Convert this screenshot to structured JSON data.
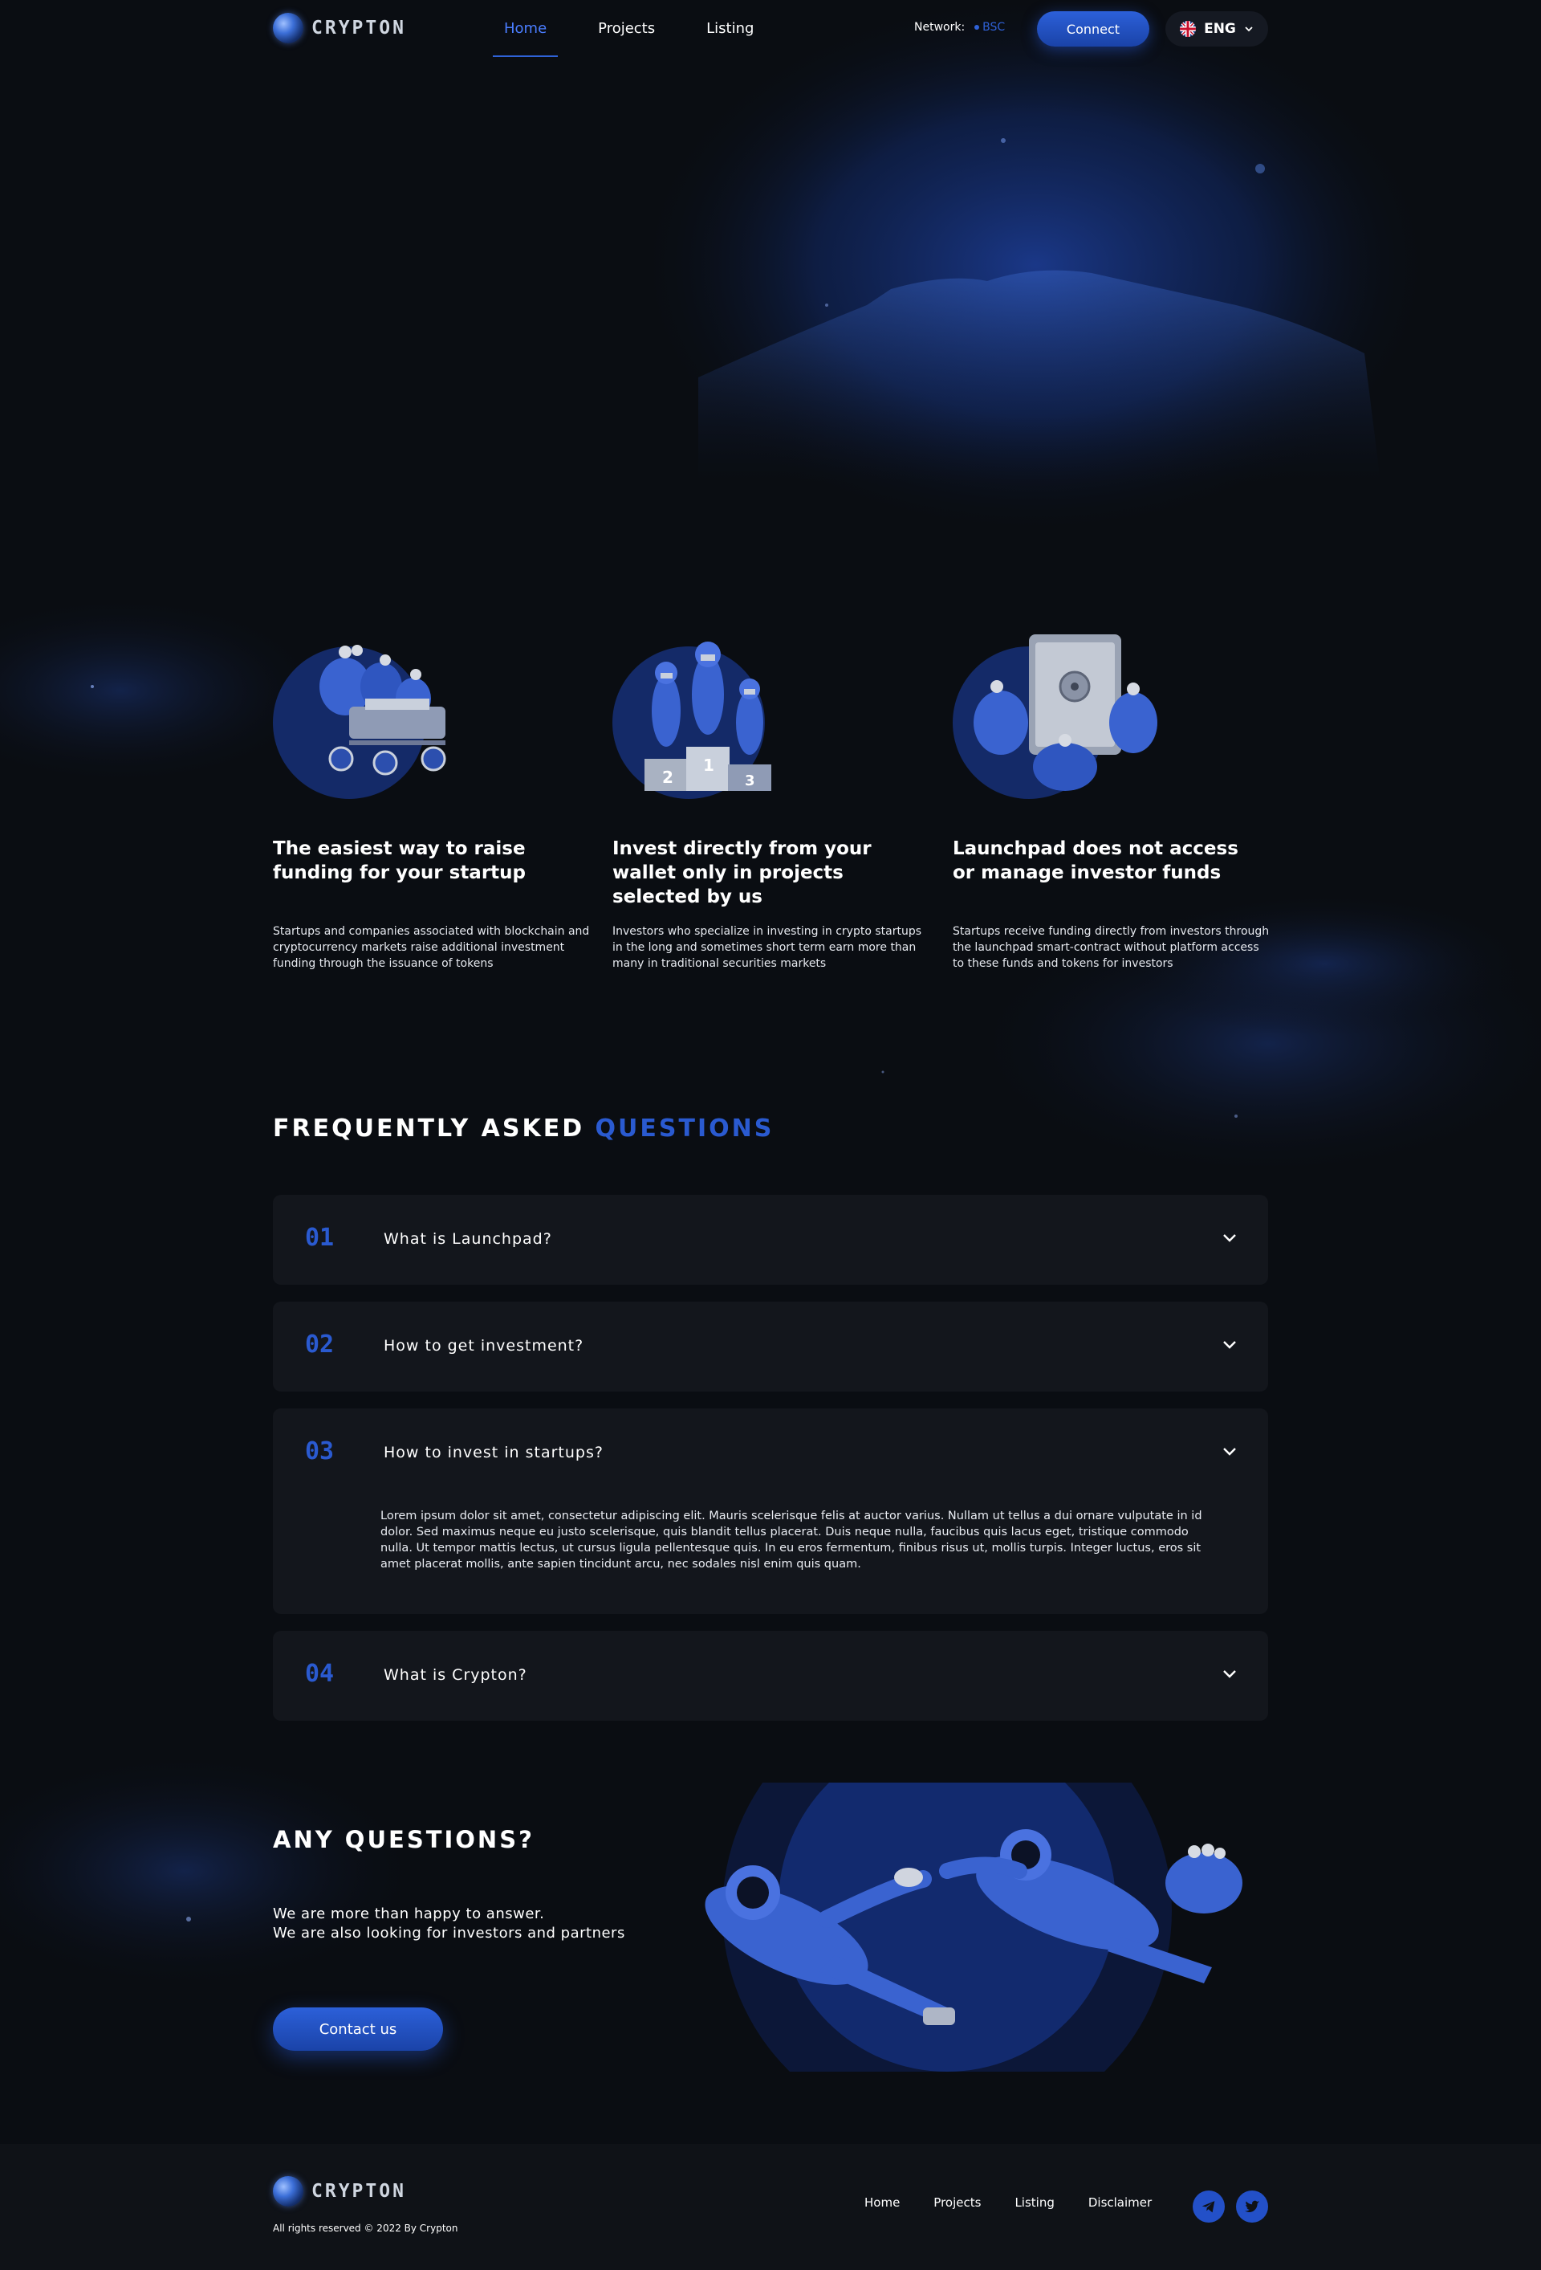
{
  "brand": {
    "name": "CRYPTON"
  },
  "header": {
    "nav": [
      "Home",
      "Projects",
      "Listing"
    ],
    "active_nav": "Home",
    "network_label": "Network:",
    "network_value": "BSC",
    "connect_label": "Connect",
    "language": "ENG"
  },
  "features": [
    {
      "title": "The easiest way to raise funding for your startup",
      "text": "Startups and companies associated with blockchain and cryptocurrency markets raise additional investment funding through the issuance of tokens",
      "illustration": "money-bags-rover"
    },
    {
      "title": "Invest directly from your wallet only in projects selected by us",
      "text": "Investors who specialize in investing in crypto startups in the long and sometimes short term earn more than many in traditional securities markets",
      "illustration": "astronauts-podium"
    },
    {
      "title": "Launchpad does not access or manage investor funds",
      "text": "Startups receive funding directly from investors through the launchpad smart-contract without platform access to these funds and tokens for investors",
      "illustration": "safe-money-bags"
    }
  ],
  "faq": {
    "title_main": "FREQUENTLY ASKED",
    "title_highlight": "QUESTIONS",
    "items": [
      {
        "num": "01",
        "question": "What is Launchpad?",
        "expanded": false
      },
      {
        "num": "02",
        "question": "How to get investment?",
        "expanded": false
      },
      {
        "num": "03",
        "question": "How to invest in startups?",
        "expanded": true,
        "answer": "Lorem ipsum dolor sit amet, consectetur adipiscing elit. Mauris scelerisque felis at auctor varius. Nullam ut tellus a dui ornare vulputate in id dolor. Sed maximus neque eu justo scelerisque, quis blandit tellus placerat. Duis neque nulla, faucibus quis lacus eget, tristique commodo nulla. Ut tempor mattis lectus, ut cursus ligula pellentesque quis. In eu eros fermentum, finibus risus ut, mollis turpis. Integer luctus, eros sit amet placerat mollis, ante sapien tincidunt arcu, nec sodales nisl enim quis quam."
      },
      {
        "num": "04",
        "question": "What is Crypton?",
        "expanded": false
      }
    ]
  },
  "any_questions": {
    "title": "ANY QUESTIONS?",
    "line1": "We are more than happy to answer.",
    "line2": "We are also looking for investors and partners",
    "button": "Contact us"
  },
  "footer": {
    "copyright": "All rights reserved © 2022 By Crypton",
    "nav": [
      "Home",
      "Projects",
      "Listing",
      "Disclaimer"
    ],
    "social": [
      "telegram-icon",
      "twitter-icon"
    ]
  },
  "colors": {
    "background": "#0a0d12",
    "accent": "#2a5ad0",
    "card": "#13161c",
    "footer": "#0f1217"
  }
}
